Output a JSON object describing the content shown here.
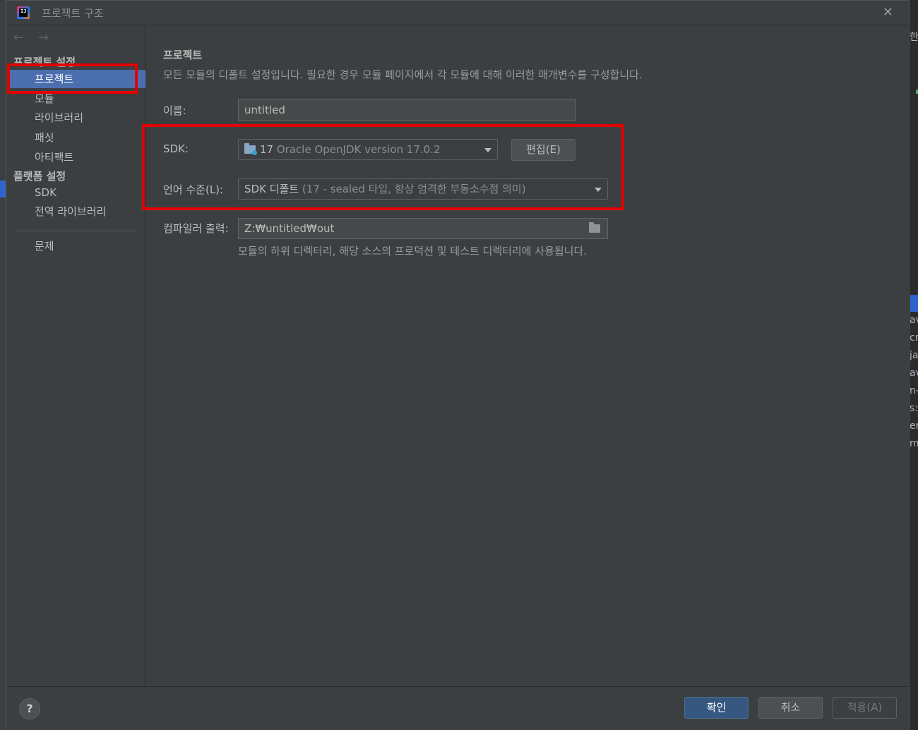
{
  "dialog": {
    "title": "프로젝트 구조",
    "close_glyph": "✕",
    "icon_text": "IJ"
  },
  "sidebar": {
    "back_glyph": "←",
    "forward_glyph": "→",
    "section_project": "프로젝트 설정",
    "project_items": [
      {
        "label": "프로젝트",
        "selected": true
      },
      {
        "label": "모듈"
      },
      {
        "label": "라이브러리"
      },
      {
        "label": "패싯"
      },
      {
        "label": "아티팩트"
      }
    ],
    "section_platform": "플랫폼 설정",
    "platform_items": [
      {
        "label": "SDK"
      },
      {
        "label": "전역 라이브러리"
      }
    ],
    "problems": "문제"
  },
  "main": {
    "title": "프로젝트",
    "description": "모든 모듈의 디폴트 설정입니다. 필요한 경우 모듈 페이지에서 각 모듈에 대해 이러한 매개변수를 구성합니다.",
    "name_label": "이름:",
    "name_value": "untitled",
    "sdk_label": "SDK:",
    "sdk_version": "17",
    "sdk_detail": "Oracle OpenJDK version 17.0.2",
    "edit_button": "편집(E)",
    "lang_label": "언어 수준(L):",
    "lang_main": "SDK 디폴트",
    "lang_detail": "(17 - sealed 타입, 항상 엄격한 부동소수점 의미)",
    "compiler_label": "컴파일러 출력:",
    "compiler_value": "Z:₩untitled₩out",
    "compiler_hint": "모듈의 하위 디렉터리, 해당 소스의 프로덕션 및 테스트 디렉터리에 사용됩니다."
  },
  "footer": {
    "help": "?",
    "ok": "확인",
    "cancel": "취소",
    "apply": "적용(A)"
  },
  "background_right_fragments": [
    "한",
    "av",
    "cm",
    "ja",
    "av",
    "n-",
    "s:",
    "er",
    "m"
  ],
  "colors": {
    "highlight_red": "#e30000",
    "selection_blue": "#4b6eaf",
    "primary_button": "#365880"
  }
}
